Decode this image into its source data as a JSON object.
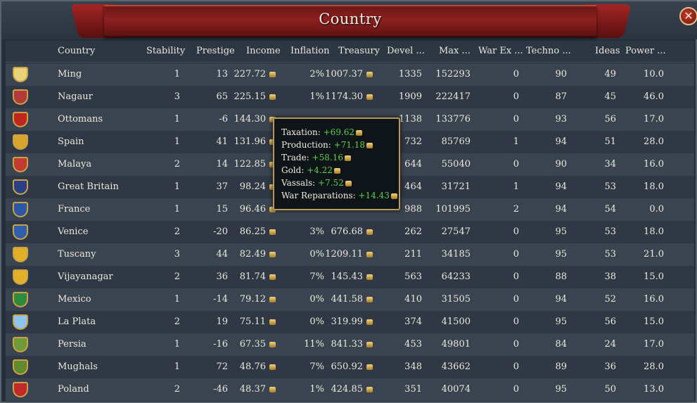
{
  "window": {
    "title": "Country",
    "close_label": "✕"
  },
  "columns": [
    "Country",
    "Stability",
    "Prestige",
    "Income",
    "Inflation",
    "Treasury",
    "Devel ...",
    "Max  ...",
    "War Ex ...",
    "Techno ...",
    "Ideas",
    "Power  ..."
  ],
  "rows": [
    {
      "country": "Ming",
      "stability": "1",
      "prestige": "13",
      "income": "227.72",
      "inflation": "2%",
      "treasury": "1007.37",
      "devel": "1335",
      "max": "152293",
      "warex": "0",
      "techno": "90",
      "ideas": "49",
      "power": "10.0",
      "flag_color": "#e8d27a"
    },
    {
      "country": "Nagaur",
      "stability": "3",
      "prestige": "65",
      "income": "225.15",
      "inflation": "1%",
      "treasury": "1174.30",
      "devel": "1909",
      "max": "222417",
      "warex": "0",
      "techno": "87",
      "ideas": "45",
      "power": "46.0",
      "flag_color": "#b33a3a"
    },
    {
      "country": "Ottomans",
      "stability": "1",
      "prestige": "-6",
      "income": "144.30",
      "inflation": "",
      "treasury": "",
      "devel": "1138",
      "max": "133776",
      "warex": "0",
      "techno": "93",
      "ideas": "56",
      "power": "17.0",
      "flag_color": "#c1261d"
    },
    {
      "country": "Spain",
      "stability": "1",
      "prestige": "41",
      "income": "131.96",
      "inflation": "",
      "treasury": "",
      "devel": "732",
      "max": "85769",
      "warex": "1",
      "techno": "94",
      "ideas": "51",
      "power": "28.0",
      "flag_color": "#d9a52c"
    },
    {
      "country": "Malaya",
      "stability": "2",
      "prestige": "14",
      "income": "122.85",
      "inflation": "",
      "treasury": "",
      "devel": "644",
      "max": "55040",
      "warex": "0",
      "techno": "90",
      "ideas": "34",
      "power": "16.0",
      "flag_color": "#c23b2f"
    },
    {
      "country": "Great Britain",
      "stability": "1",
      "prestige": "37",
      "income": "98.24",
      "inflation": "",
      "treasury": "",
      "devel": "464",
      "max": "31721",
      "warex": "1",
      "techno": "94",
      "ideas": "53",
      "power": "18.0",
      "flag_color": "#2a3f86"
    },
    {
      "country": "France",
      "stability": "1",
      "prestige": "15",
      "income": "96.46",
      "inflation": "",
      "treasury": "",
      "devel": "988",
      "max": "101995",
      "warex": "2",
      "techno": "94",
      "ideas": "54",
      "power": "0.0",
      "flag_color": "#2c56a8"
    },
    {
      "country": "Venice",
      "stability": "2",
      "prestige": "-20",
      "income": "86.25",
      "inflation": "3%",
      "treasury": "676.68",
      "devel": "262",
      "max": "27547",
      "warex": "0",
      "techno": "95",
      "ideas": "53",
      "power": "18.0",
      "flag_color": "#2f5fae"
    },
    {
      "country": "Tuscany",
      "stability": "3",
      "prestige": "44",
      "income": "82.49",
      "inflation": "0%",
      "treasury": "1209.11",
      "devel": "211",
      "max": "34185",
      "warex": "0",
      "techno": "95",
      "ideas": "53",
      "power": "21.0",
      "flag_color": "#e0b028"
    },
    {
      "country": "Vijayanagar",
      "stability": "2",
      "prestige": "36",
      "income": "81.74",
      "inflation": "7%",
      "treasury": "145.43",
      "devel": "563",
      "max": "64233",
      "warex": "0",
      "techno": "88",
      "ideas": "38",
      "power": "15.0",
      "flag_color": "#e2b12c"
    },
    {
      "country": "Mexico",
      "stability": "1",
      "prestige": "-14",
      "income": "79.12",
      "inflation": "0%",
      "treasury": "441.58",
      "devel": "410",
      "max": "31505",
      "warex": "0",
      "techno": "94",
      "ideas": "52",
      "power": "16.0",
      "flag_color": "#2e8a3c"
    },
    {
      "country": "La Plata",
      "stability": "2",
      "prestige": "19",
      "income": "75.11",
      "inflation": "0%",
      "treasury": "319.99",
      "devel": "374",
      "max": "41500",
      "warex": "0",
      "techno": "95",
      "ideas": "56",
      "power": "15.0",
      "flag_color": "#8fc4ec"
    },
    {
      "country": "Persia",
      "stability": "1",
      "prestige": "-16",
      "income": "67.35",
      "inflation": "11%",
      "treasury": "841.33",
      "devel": "453",
      "max": "49801",
      "warex": "0",
      "techno": "84",
      "ideas": "24",
      "power": "17.0",
      "flag_color": "#6e9a3a"
    },
    {
      "country": "Mughals",
      "stability": "1",
      "prestige": "72",
      "income": "48.76",
      "inflation": "7%",
      "treasury": "650.92",
      "devel": "348",
      "max": "43662",
      "warex": "0",
      "techno": "89",
      "ideas": "36",
      "power": "28.0",
      "flag_color": "#5f8a2e"
    },
    {
      "country": "Poland",
      "stability": "2",
      "prestige": "-46",
      "income": "48.37",
      "inflation": "1%",
      "treasury": "424.85",
      "devel": "351",
      "max": "40074",
      "warex": "0",
      "techno": "95",
      "ideas": "50",
      "power": "13.0",
      "flag_color": "#c22a2a"
    }
  ],
  "tooltip": {
    "lines": [
      {
        "label": "Taxation:",
        "value": "+69.62"
      },
      {
        "label": "Production:",
        "value": "+71.18"
      },
      {
        "label": "Trade:",
        "value": "+58.16"
      },
      {
        "label": "Gold:",
        "value": "+4.22"
      },
      {
        "label": "Vassals:",
        "value": "+7.52"
      },
      {
        "label": "War Reparations:",
        "value": "+14.43"
      }
    ]
  }
}
